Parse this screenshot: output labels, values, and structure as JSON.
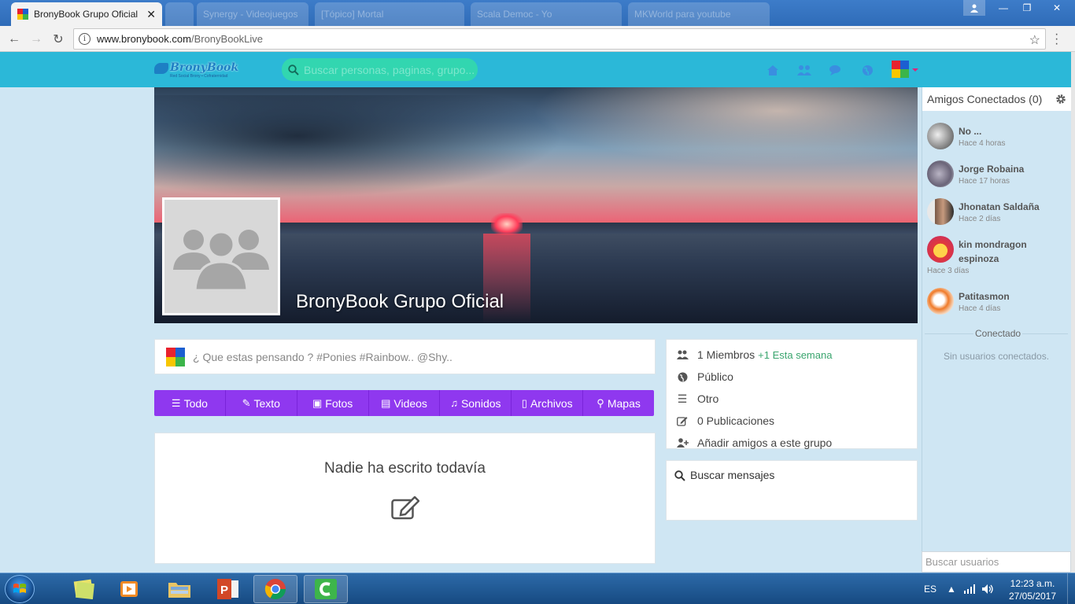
{
  "browser": {
    "tabs": [
      {
        "label": "BronyBook Grupo Oficial",
        "active": true
      },
      {
        "label": "",
        "active": false
      },
      {
        "label": "Synergy - Videojuegos",
        "active": false
      },
      {
        "label": "[Tópico] Mortal",
        "active": false
      },
      {
        "label": "Scala Democ - Yo",
        "active": false
      },
      {
        "label": "MKWorld para youtube",
        "active": false
      }
    ],
    "url_host": "www.bronybook.com",
    "url_path": "/BronyBookLive"
  },
  "header": {
    "logo_text": "BronyBook",
    "logo_tagline": "Red Social Brony • Cofraternidad",
    "search_placeholder": "Buscar personas, paginas, grupo..."
  },
  "group": {
    "title": "BronyBook Grupo Oficial",
    "composer_placeholder": "¿ Que estas pensando ? #Ponies #Rainbow.. @Shy..",
    "filters": [
      {
        "icon": "list-icon",
        "label": "Todo"
      },
      {
        "icon": "pencil-icon",
        "label": "Texto"
      },
      {
        "icon": "image-icon",
        "label": "Fotos"
      },
      {
        "icon": "film-icon",
        "label": "Videos"
      },
      {
        "icon": "music-icon",
        "label": "Sonidos"
      },
      {
        "icon": "file-icon",
        "label": "Archivos"
      },
      {
        "icon": "map-marker-icon",
        "label": "Mapas"
      }
    ],
    "empty_message": "Nadie ha escrito todavía",
    "info": {
      "members": "1 Miembros",
      "members_week": "+1 Esta semana",
      "privacy": "Público",
      "category": "Otro",
      "posts": "0 Publicaciones",
      "add_friends": "Añadir amigos a este grupo"
    },
    "search_messages": "Buscar mensajes"
  },
  "sidebar": {
    "title": "Amigos Conectados (0)",
    "friends": [
      {
        "name": "No ...",
        "time": "Hace 4 horas"
      },
      {
        "name": "Jorge Robaina",
        "time": "Hace 17 horas"
      },
      {
        "name": "Jhonatan Saldaña",
        "time": "Hace 2 días"
      },
      {
        "name": "kin mondragon espinoza",
        "time": "Hace 3 días"
      },
      {
        "name": "Patitasmon",
        "time": "Hace 4 días"
      }
    ],
    "connected_label": "Conectado",
    "no_connected": "Sin usuarios conectados.",
    "search_placeholder": "Buscar usuarios"
  },
  "colors": {
    "header": "#2bb8d8",
    "search_bg": "#32d6b0",
    "filter_bar": "#8f38ef",
    "page_bg": "#cfe6f3"
  },
  "taskbar": {
    "lang": "ES",
    "time": "12:23 a.m.",
    "date": "27/05/2017"
  }
}
